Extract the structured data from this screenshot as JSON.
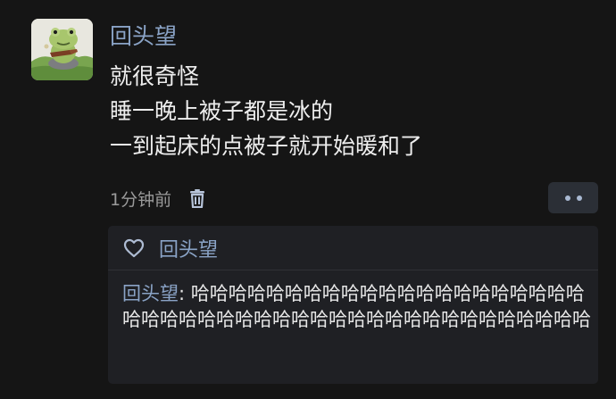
{
  "post": {
    "username": "回头望",
    "lines": [
      "就很奇怪",
      "睡一晚上被子都是冰的",
      "一到起床的点被子就开始暖和了"
    ],
    "time": "1分钟前",
    "delete_icon": "trash-icon",
    "more_icon": "ellipsis-icon"
  },
  "likes": {
    "icon": "heart-icon",
    "user": "回头望"
  },
  "reply": {
    "user": "回头望",
    "separator": ": ",
    "text": "哈哈哈哈哈哈哈哈哈哈哈哈哈哈哈哈哈哈哈哈哈哈哈哈哈哈哈哈哈哈哈哈哈哈哈哈哈哈哈哈哈哈哈哈哈哈"
  },
  "colors": {
    "background": "#151515",
    "username": "#8aa3c6",
    "text": "#eeeeee",
    "meta": "#9a9a9a",
    "panel": "#1f2024",
    "more_button": "#2b2f36"
  }
}
